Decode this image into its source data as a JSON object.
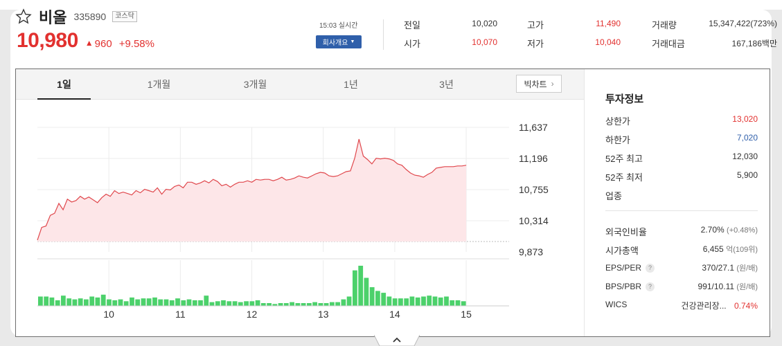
{
  "header": {
    "name": "비올",
    "code": "335890",
    "market": "코스닥",
    "price": "10,980",
    "change": "960",
    "change_rate": "+9.58%",
    "realtime": "15:03 실시간",
    "company_button": "회사개요"
  },
  "quote": {
    "prev_label": "전일",
    "prev_value": "10,020",
    "open_label": "시가",
    "open_value": "10,070",
    "high_label": "고가",
    "high_value": "11,490",
    "low_label": "저가",
    "low_value": "10,040",
    "volume_label": "거래량",
    "volume_value": "15,347,422(723%)",
    "amount_label": "거래대금",
    "amount_value": "167,186백만"
  },
  "chart": {
    "tabs": [
      "1일",
      "1개월",
      "3개월",
      "1년",
      "3년"
    ],
    "active_tab": "1일",
    "bigchart_label": "빅차트"
  },
  "info": {
    "title": "투자정보",
    "rows1": [
      {
        "label": "상한가",
        "value": "13,020",
        "color": "red"
      },
      {
        "label": "하한가",
        "value": "7,020",
        "color": "blue"
      },
      {
        "label": "52주 최고",
        "value": "12,030",
        "color": ""
      },
      {
        "label": "52주 최저",
        "value": "5,900",
        "color": ""
      },
      {
        "label": "업종",
        "value": "",
        "color": ""
      }
    ],
    "foreign_label": "외국인비율",
    "foreign_value": "2.70%",
    "foreign_sub": "(+0.48%)",
    "mcap_label": "시가총액",
    "mcap_value": "6,455",
    "mcap_sub": "억(109위)",
    "eps_label": "EPS/PER",
    "eps_value": "370/27.1",
    "eps_sub": "(원/배)",
    "bps_label": "BPS/PBR",
    "bps_value": "991/10.11",
    "bps_sub": "(원/배)",
    "wics_label": "WICS",
    "wics_value": "건강관리장...",
    "wics_rate": "0.74%"
  },
  "colors": {
    "up": "#e2312f",
    "down": "#2f5faa",
    "volume": "#4cd16b",
    "line": "#e0474c",
    "fill": "#fde6e8"
  },
  "chart_data": {
    "type": "line",
    "yticks": [
      11637,
      11196,
      10755,
      10314,
      9873
    ],
    "ylim": [
      9873,
      11637
    ],
    "xticks": [
      "10",
      "11",
      "12",
      "13",
      "14",
      "15"
    ],
    "xlim": [
      9.0,
      15.6
    ],
    "prev_close": 10020,
    "price": {
      "x": [
        9.0,
        9.06,
        9.12,
        9.18,
        9.24,
        9.3,
        9.36,
        9.42,
        9.48,
        9.54,
        9.6,
        9.66,
        9.72,
        9.78,
        9.84,
        9.9,
        9.96,
        10.02,
        10.08,
        10.14,
        10.2,
        10.26,
        10.32,
        10.38,
        10.44,
        10.5,
        10.56,
        10.62,
        10.68,
        10.74,
        10.8,
        10.86,
        10.92,
        10.98,
        11.04,
        11.1,
        11.16,
        11.22,
        11.28,
        11.34,
        11.4,
        11.46,
        11.52,
        11.58,
        11.64,
        11.7,
        11.76,
        11.82,
        11.88,
        11.94,
        12.0,
        12.06,
        12.12,
        12.18,
        12.24,
        12.3,
        12.36,
        12.42,
        12.48,
        12.54,
        12.6,
        12.66,
        12.72,
        12.78,
        12.84,
        12.9,
        12.96,
        13.02,
        13.08,
        13.14,
        13.2,
        13.26,
        13.32,
        13.38,
        13.44,
        13.5,
        13.56,
        13.62,
        13.68,
        13.74,
        13.8,
        13.86,
        13.92,
        13.98,
        14.04,
        14.1,
        14.16,
        14.22,
        14.28,
        14.34,
        14.4,
        14.46,
        14.52,
        14.58,
        14.64,
        14.7,
        14.76,
        14.82,
        14.88,
        14.94,
        15.0
      ],
      "y": [
        10040,
        10220,
        10240,
        10390,
        10420,
        10560,
        10470,
        10620,
        10580,
        10600,
        10660,
        10620,
        10650,
        10610,
        10570,
        10640,
        10690,
        10660,
        10740,
        10700,
        10720,
        10700,
        10680,
        10740,
        10710,
        10760,
        10740,
        10720,
        10780,
        10690,
        10760,
        10750,
        10800,
        10820,
        10780,
        10860,
        10860,
        10830,
        10850,
        10880,
        10850,
        10900,
        10870,
        10810,
        10830,
        10790,
        10830,
        10860,
        10860,
        10880,
        10860,
        10900,
        10890,
        10900,
        10900,
        10880,
        10900,
        10930,
        10890,
        10900,
        10920,
        10950,
        10930,
        10920,
        10950,
        10980,
        11000,
        10990,
        10950,
        10940,
        10950,
        10980,
        11010,
        11020,
        11200,
        11470,
        11230,
        11180,
        11120,
        11200,
        11190,
        11200,
        11190,
        11170,
        11120,
        11100,
        11040,
        10990,
        10960,
        10950,
        10930,
        10970,
        11000,
        11060,
        11070,
        11080,
        11080,
        11080,
        11090,
        11090,
        11100
      ]
    },
    "volume": [
      1.0,
      1.0,
      0.9,
      0.6,
      1.1,
      0.8,
      0.7,
      0.8,
      0.7,
      1.0,
      0.9,
      1.2,
      0.7,
      0.6,
      0.7,
      0.5,
      0.9,
      0.7,
      0.8,
      0.8,
      0.9,
      0.7,
      0.7,
      0.6,
      0.8,
      0.6,
      0.7,
      0.6,
      0.6,
      1.1,
      0.4,
      0.5,
      0.6,
      0.5,
      0.5,
      0.4,
      0.5,
      0.5,
      0.6,
      0.3,
      0.3,
      0.2,
      0.3,
      0.3,
      0.4,
      0.3,
      0.3,
      0.3,
      0.4,
      0.3,
      0.3,
      0.4,
      0.4,
      0.7,
      1.0,
      3.8,
      4.3,
      3.0,
      2.0,
      1.6,
      1.4,
      1.0,
      0.8,
      0.8,
      0.8,
      1.0,
      0.9,
      1.0,
      1.1,
      1.0,
      0.9,
      1.0,
      0.6,
      0.6,
      0.5
    ]
  }
}
